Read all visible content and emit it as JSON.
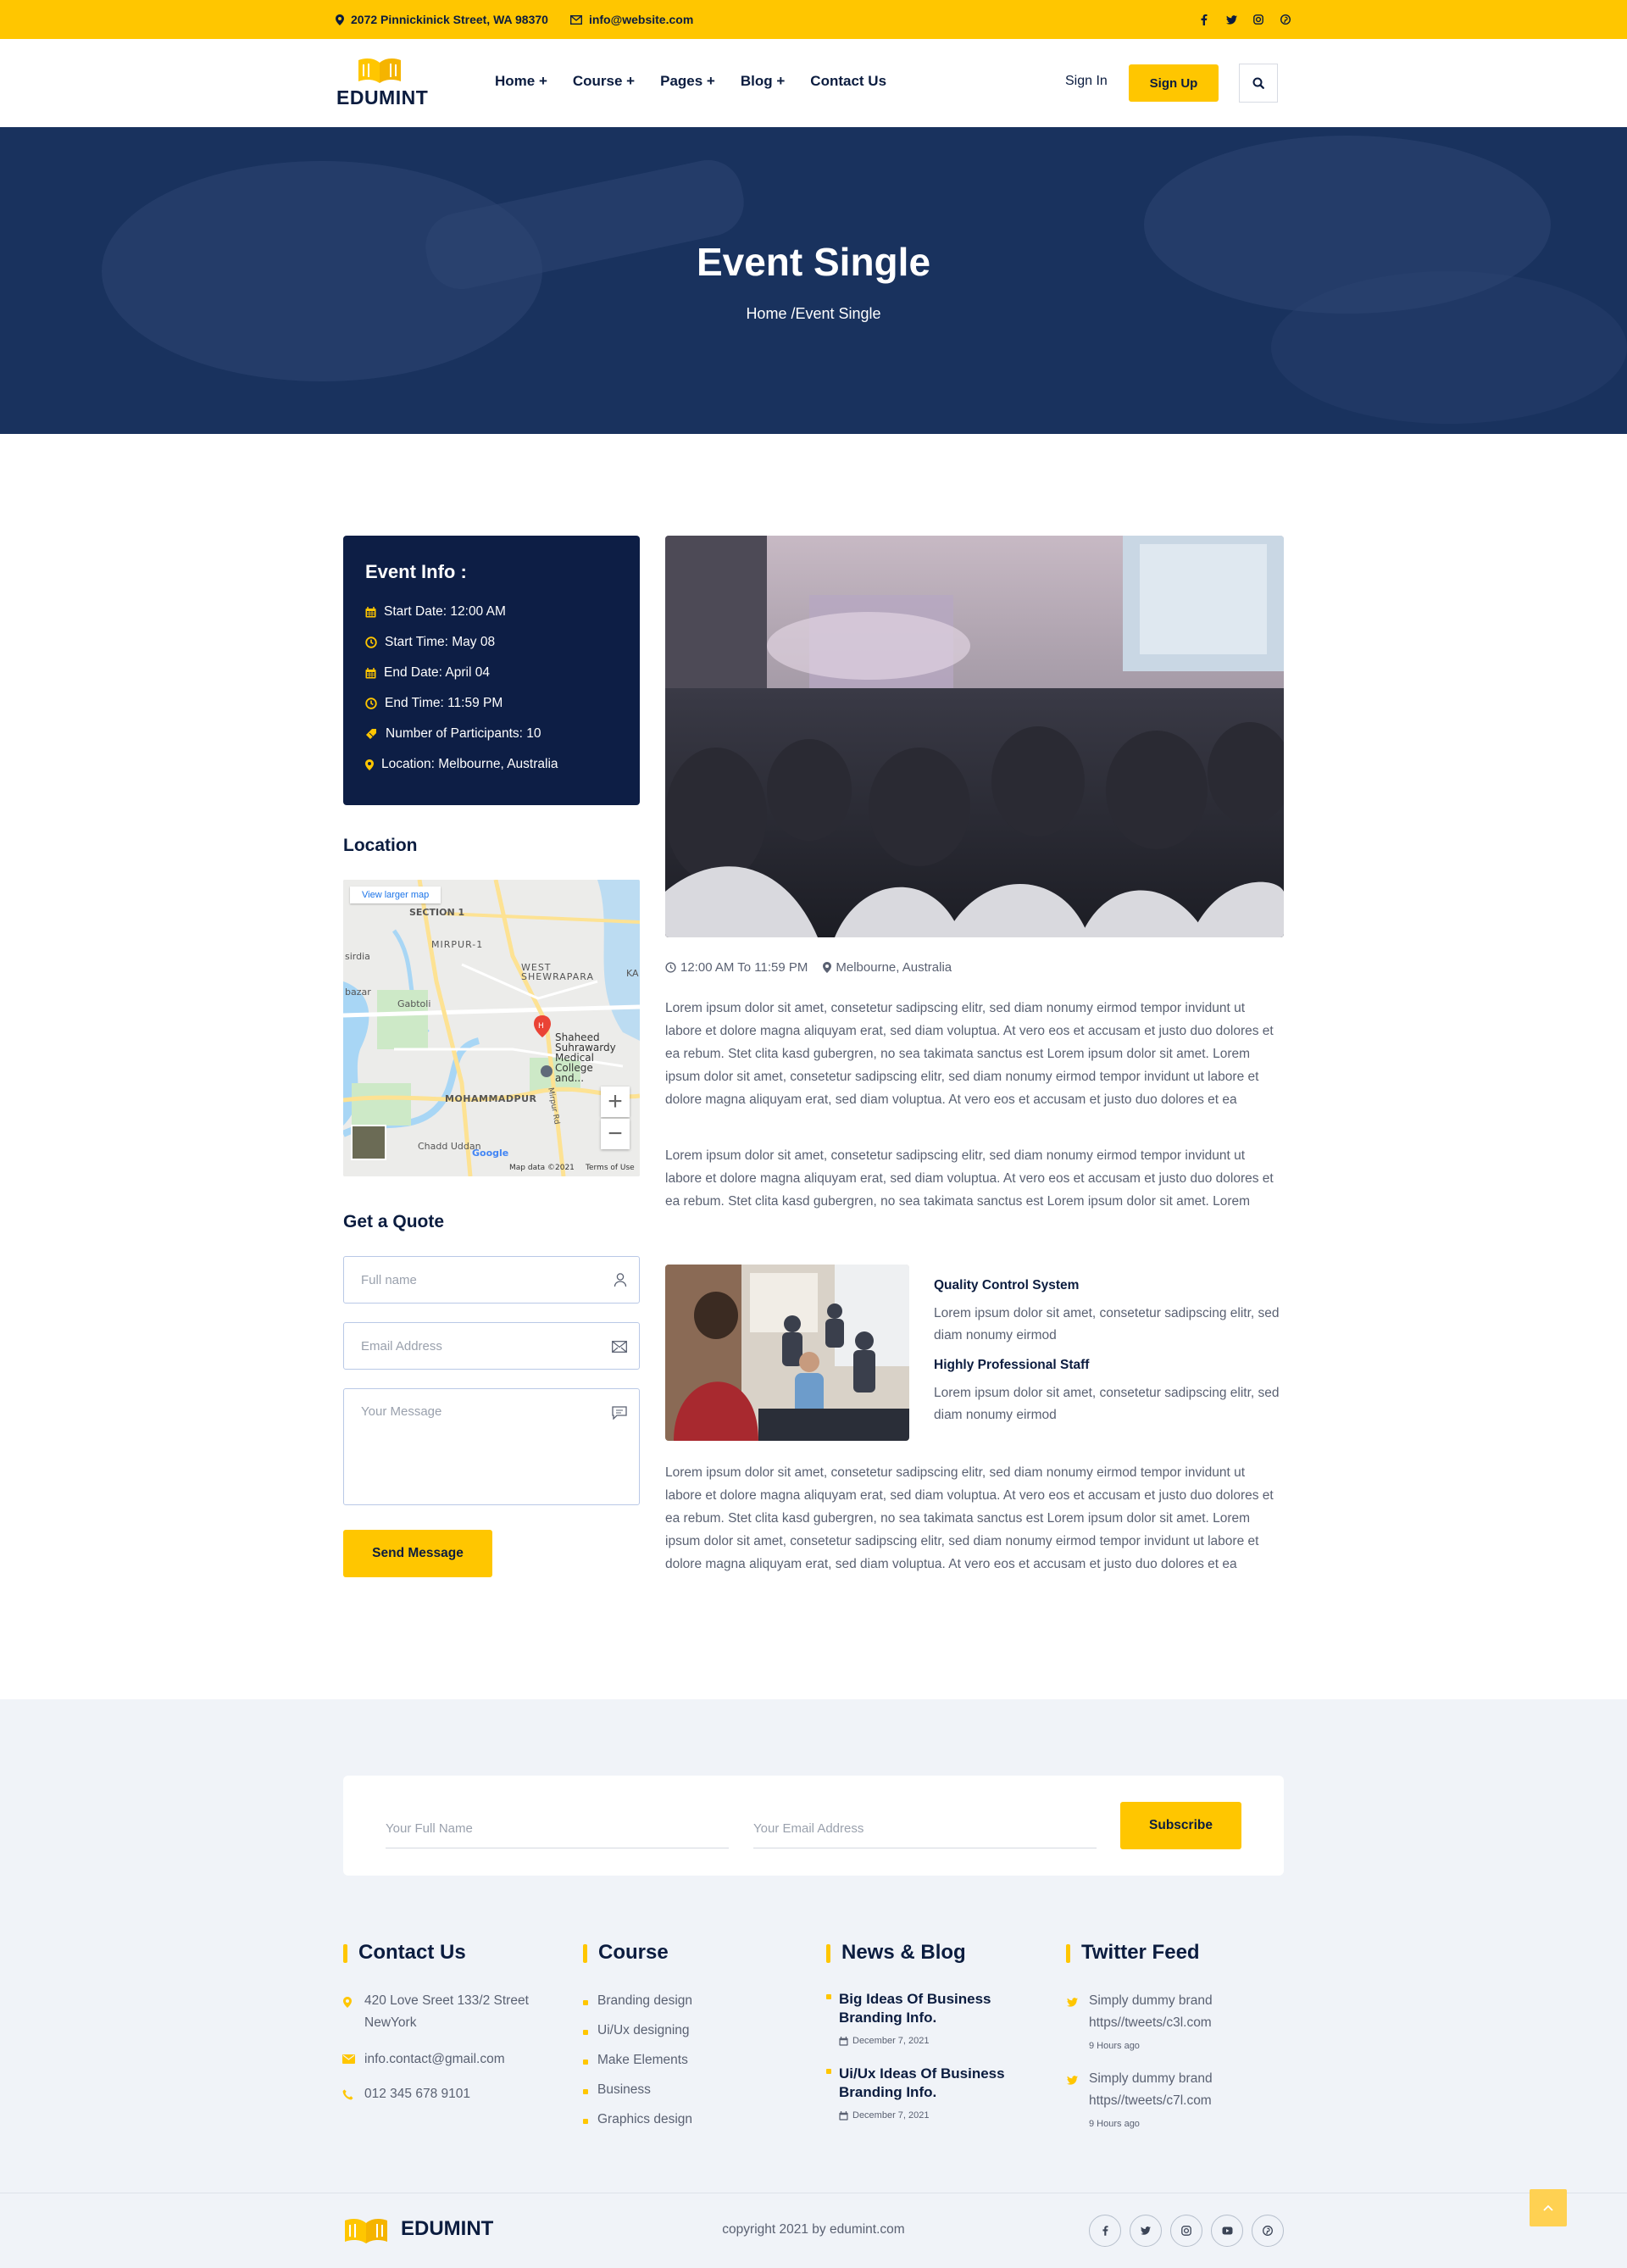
{
  "topbar": {
    "address": "2072 Pinnickinick Street, WA 98370",
    "email": "info@website.com",
    "social_icons": [
      "facebook-icon",
      "twitter-icon",
      "instagram-icon",
      "pinterest-icon"
    ]
  },
  "header": {
    "logo_text": "EDUMINT",
    "nav": [
      "Home +",
      "Course +",
      "Pages +",
      "Blog +",
      "Contact Us"
    ],
    "sign_in": "Sign In",
    "sign_up": "Sign Up"
  },
  "hero": {
    "title": "Event Single",
    "breadcrumb_home": "Home",
    "breadcrumb_sep": "/",
    "breadcrumb_current": "Event Single"
  },
  "event_info": {
    "title": "Event Info :",
    "items": [
      {
        "icon": "calendar-icon",
        "text": "Start Date: 12:00 AM"
      },
      {
        "icon": "clock-icon",
        "text": "Start Time: May 08"
      },
      {
        "icon": "calendar-icon",
        "text": "End Date: April 04"
      },
      {
        "icon": "clock-icon",
        "text": "End Time: 11:59 PM"
      },
      {
        "icon": "ticket-icon",
        "text": "Number of Participants: 10"
      },
      {
        "icon": "location-pin-icon",
        "text": "Location: Melbourne, Australia"
      }
    ]
  },
  "location": {
    "title": "Location",
    "map": {
      "view_larger": "View larger map",
      "labels": [
        "SECTION 1",
        "MIRPUR-1",
        "WEST SHEWRAPARA",
        "KA",
        "sirdia",
        "bazar",
        "Gabtoli",
        "Shaheed Suhrawardy Medical College and...",
        "MOHAMMADPUR",
        "Mirpur Rd",
        "Chadd Uddan",
        "Google"
      ],
      "attribution": "Map data ©2021",
      "terms": "Terms of Use",
      "zoom_in": "+",
      "zoom_out": "−"
    }
  },
  "quote": {
    "title": "Get a Quote",
    "name_placeholder": "Full name",
    "email_placeholder": "Email Address",
    "message_placeholder": "Your Message",
    "send": "Send Message"
  },
  "content": {
    "time": "12:00 AM To 11:59 PM",
    "place": "Melbourne, Australia",
    "para1": "Lorem ipsum dolor sit amet, consetetur sadipscing elitr, sed diam nonumy eirmod tempor invidunt ut labore et dolore magna aliquyam erat, sed diam voluptua. At vero eos et accusam et justo duo dolores et ea rebum. Stet clita kasd gubergren, no sea takimata sanctus est Lorem ipsum dolor sit amet. Lorem ipsum dolor sit amet, consetetur sadipscing elitr, sed diam nonumy eirmod tempor invidunt ut labore et dolore magna aliquyam erat, sed diam voluptua. At vero eos et accusam et justo duo dolores et ea",
    "para2": "Lorem ipsum dolor sit amet, consetetur sadipscing elitr, sed diam nonumy eirmod tempor invidunt ut labore et dolore magna aliquyam erat, sed diam voluptua. At vero eos et accusam et justo duo dolores et ea rebum. Stet clita kasd gubergren, no sea takimata sanctus est Lorem ipsum dolor sit amet. Lorem",
    "features": [
      {
        "title": "Quality Control System",
        "text": "Lorem ipsum dolor sit amet, consetetur sadipscing elitr, sed diam nonumy eirmod"
      },
      {
        "title": "Highly Professional Staff",
        "text": "Lorem ipsum dolor sit amet, consetetur sadipscing elitr, sed diam nonumy eirmod"
      }
    ],
    "para3": "Lorem ipsum dolor sit amet, consetetur sadipscing elitr, sed diam nonumy eirmod tempor invidunt ut labore et dolore magna aliquyam erat, sed diam voluptua. At vero eos et accusam et justo duo dolores et ea rebum. Stet clita kasd gubergren, no sea takimata sanctus est Lorem ipsum dolor sit amet. Lorem ipsum dolor sit amet, consetetur sadipscing elitr, sed diam nonumy eirmod tempor invidunt ut labore et dolore magna aliquyam erat, sed diam voluptua. At vero eos et accusam et justo duo dolores et ea"
  },
  "newsletter": {
    "name_placeholder": "Your Full Name",
    "email_placeholder": "Your Email Address",
    "subscribe": "Subscribe"
  },
  "footer": {
    "contact": {
      "title": "Contact Us",
      "address_line1": "420 Love Sreet 133/2 Street",
      "address_line2": "NewYork",
      "email": "info.contact@gmail.com",
      "phone": "012 345 678 9101"
    },
    "course": {
      "title": "Course",
      "items": [
        "Branding design",
        "Ui/Ux designing",
        "Make Elements",
        "Business",
        "Graphics design"
      ]
    },
    "blog": {
      "title": "News & Blog",
      "posts": [
        {
          "title": "Big Ideas Of Business Branding Info.",
          "date": "December 7, 2021"
        },
        {
          "title": "Ui/Ux Ideas Of Business Branding Info.",
          "date": "December 7, 2021"
        }
      ]
    },
    "twitter": {
      "title": "Twitter Feed",
      "tweets": [
        {
          "line1": "Simply dummy brand",
          "line2": "https//tweets/c3l.com",
          "time": "9 Hours ago"
        },
        {
          "line1": "Simply dummy brand",
          "line2": "https//tweets/c7l.com",
          "time": "9 Hours ago"
        }
      ]
    },
    "logo_text": "EDUMINT",
    "copyright": "copyright 2021 by edumint.com",
    "social_icons": [
      "facebook-icon",
      "twitter-icon",
      "instagram-icon",
      "youtube-icon",
      "pinterest-icon"
    ]
  },
  "colors": {
    "accent": "#ffc600",
    "navy": "#0d1e45",
    "hero": "#19325e",
    "footer_bg": "#f0f3f8"
  }
}
